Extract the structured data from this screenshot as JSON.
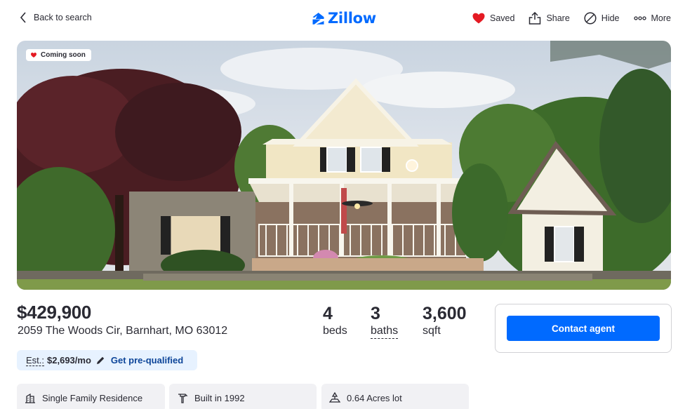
{
  "header": {
    "back_label": "Back to search",
    "logo_text": "Zillow",
    "actions": {
      "saved": "Saved",
      "share": "Share",
      "hide": "Hide",
      "more": "More"
    }
  },
  "photo": {
    "badge": "Coming soon"
  },
  "listing": {
    "price": "$429,900",
    "address": "2059 The Woods Cir, Barnhart, MO 63012",
    "beds": {
      "value": "4",
      "label": "beds"
    },
    "baths": {
      "value": "3",
      "label": "baths"
    },
    "sqft": {
      "value": "3,600",
      "label": "sqft"
    }
  },
  "estimate": {
    "label": "Est.:",
    "value": "$2,693/mo",
    "link": "Get pre-qualified"
  },
  "contact": {
    "button": "Contact agent"
  },
  "facts": [
    {
      "label": "Single Family Residence",
      "icon": "building-icon"
    },
    {
      "label": "Built in 1992",
      "icon": "hammer-icon"
    },
    {
      "label": "0.64 Acres lot",
      "icon": "lot-icon"
    }
  ],
  "colors": {
    "brand": "#006aff",
    "heart": "#e41a23",
    "estimate_bg": "#e7f2ff",
    "link": "#0d4599",
    "fact_bg": "#f1f1f4"
  }
}
